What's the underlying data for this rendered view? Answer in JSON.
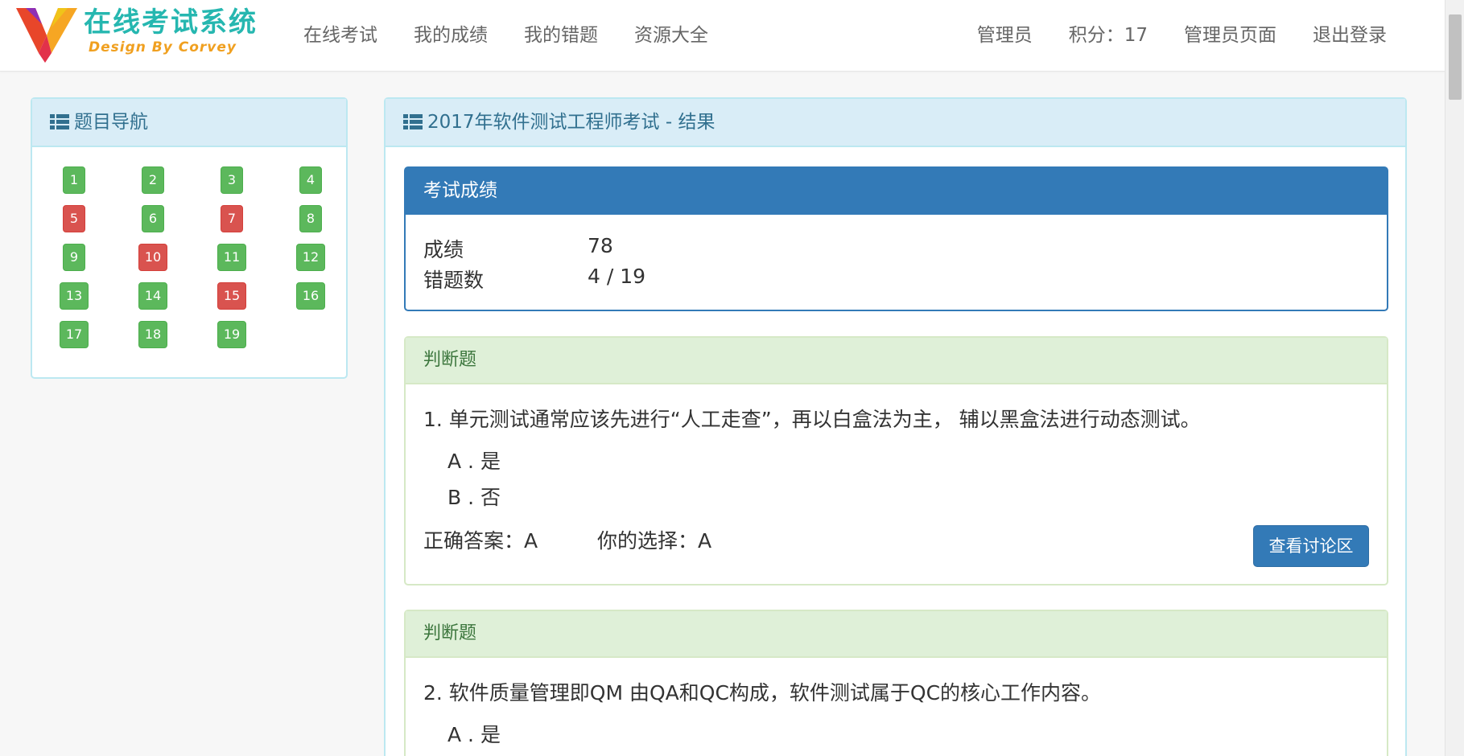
{
  "brand": {
    "title": "在线考试系统",
    "subtitle": "Design By Corvey",
    "logo_colors": [
      "#e8462a",
      "#f6a623",
      "#e2314a",
      "#8e2fb5"
    ]
  },
  "nav": {
    "left": [
      "在线考试",
      "我的成绩",
      "我的错题",
      "资源大全"
    ],
    "user": "管理员",
    "points": "积分：17",
    "admin_page": "管理员页面",
    "logout": "退出登录"
  },
  "question_nav": {
    "title": "题目导航",
    "items": [
      {
        "label": "1",
        "status": "correct"
      },
      {
        "label": "2",
        "status": "correct"
      },
      {
        "label": "3",
        "status": "correct"
      },
      {
        "label": "4",
        "status": "correct"
      },
      {
        "label": "5",
        "status": "wrong"
      },
      {
        "label": "6",
        "status": "correct"
      },
      {
        "label": "7",
        "status": "wrong"
      },
      {
        "label": "8",
        "status": "correct"
      },
      {
        "label": "9",
        "status": "correct"
      },
      {
        "label": "10",
        "status": "wrong"
      },
      {
        "label": "11",
        "status": "correct"
      },
      {
        "label": "12",
        "status": "correct"
      },
      {
        "label": "13",
        "status": "correct"
      },
      {
        "label": "14",
        "status": "correct"
      },
      {
        "label": "15",
        "status": "wrong"
      },
      {
        "label": "16",
        "status": "correct"
      },
      {
        "label": "17",
        "status": "correct"
      },
      {
        "label": "18",
        "status": "correct"
      },
      {
        "label": "19",
        "status": "correct"
      }
    ]
  },
  "result": {
    "title": "2017年软件测试工程师考试 - 结果",
    "score_panel": {
      "heading": "考试成绩",
      "score_label": "成绩",
      "score_value": "78",
      "wrong_label": "错题数",
      "wrong_value": "4 / 19"
    },
    "questions": [
      {
        "type": "判断题",
        "text": "1. 单元测试通常应该先进行“人工走查”，再以白盒法为主， 辅以黑盒法进行动态测试。",
        "options": [
          "A . 是",
          "B . 否"
        ],
        "correct": "正确答案：A",
        "choice": "你的选择：A",
        "discuss": "查看讨论区"
      },
      {
        "type": "判断题",
        "text": "2. 软件质量管理即QM 由QA和QC构成，软件测试属于QC的核心工作内容。",
        "options": [
          "A . 是"
        ]
      }
    ]
  },
  "colors": {
    "correct": "#5cb85c",
    "wrong": "#d9534f",
    "primary": "#337ab7",
    "info_bg": "#d9edf7",
    "success_bg": "#dff0d8"
  }
}
